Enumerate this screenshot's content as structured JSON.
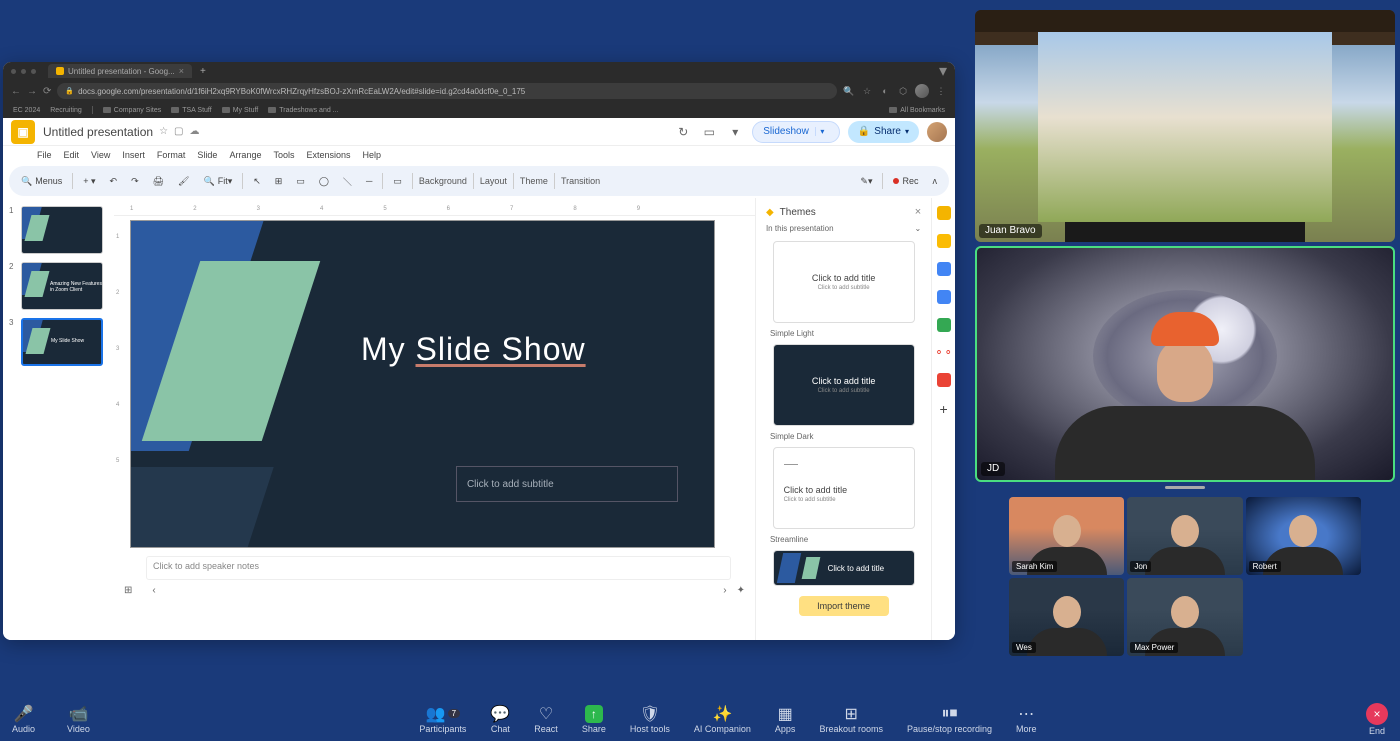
{
  "browser": {
    "tab_title": "Untitled presentation - Goog...",
    "url": "docs.google.com/presentation/d/1f6iH2xq9RYBoK0fWrcxRHZrqyHfzsBOJ-zXmRcEaLW2A/edit#slide=id.g2cd4a0dcf0e_0_175",
    "bookmarks": [
      "EC 2024",
      "Recruiting",
      "Company Sites",
      "TSA Stuff",
      "My Stuff",
      "Tradeshows and ..."
    ],
    "all_bookmarks": "All Bookmarks"
  },
  "app": {
    "title": "Untitled presentation",
    "menus": [
      "File",
      "Edit",
      "View",
      "Insert",
      "Format",
      "Slide",
      "Arrange",
      "Tools",
      "Extensions",
      "Help"
    ],
    "slideshow": "Slideshow",
    "share": "Share"
  },
  "toolbar": {
    "search": "Menus",
    "fit": "Fit",
    "background": "Background",
    "layout": "Layout",
    "theme": "Theme",
    "transition": "Transition",
    "rec": "Rec"
  },
  "slides": [
    {
      "num": "1",
      "title": ""
    },
    {
      "num": "2",
      "title": "Amazing New Features in Zoom Client"
    },
    {
      "num": "3",
      "title": "My Slide Show"
    }
  ],
  "canvas": {
    "title_pre": "My ",
    "title_under": "Slide Show",
    "subtitle_ph": "Click to add subtitle",
    "notes_ph": "Click to add speaker notes"
  },
  "themes": {
    "panel_title": "Themes",
    "section": "In this presentation",
    "cards": [
      {
        "name": "Simple Light",
        "title": "Click to add title",
        "sub": "Click to add subtitle"
      },
      {
        "name": "Simple Dark",
        "title": "Click to add title",
        "sub": "Click to add subtitle"
      },
      {
        "name": "Streamline",
        "title": "Click to add title",
        "sub": "Click to add subtitle"
      },
      {
        "name": "",
        "title": "Click to add title",
        "sub": ""
      }
    ],
    "import": "Import theme"
  },
  "video": {
    "tiles": [
      {
        "name": "Juan Bravo"
      },
      {
        "name": "JD"
      }
    ],
    "small": [
      "Sarah Kim",
      "Jon",
      "Robert",
      "Wes",
      "Max Power"
    ]
  },
  "zoom": {
    "items": [
      {
        "label": "Audio",
        "icon": "mic"
      },
      {
        "label": "Video",
        "icon": "camera"
      },
      {
        "label": "Participants",
        "icon": "people",
        "count": "7"
      },
      {
        "label": "Chat",
        "icon": "chat"
      },
      {
        "label": "React",
        "icon": "heart"
      },
      {
        "label": "Share",
        "icon": "share"
      },
      {
        "label": "Host tools",
        "icon": "shield"
      },
      {
        "label": "AI Companion",
        "icon": "sparkle"
      },
      {
        "label": "Apps",
        "icon": "grid"
      },
      {
        "label": "Breakout rooms",
        "icon": "rooms"
      },
      {
        "label": "Pause/stop recording",
        "icon": "record"
      },
      {
        "label": "More",
        "icon": "more"
      }
    ],
    "end": "End"
  }
}
